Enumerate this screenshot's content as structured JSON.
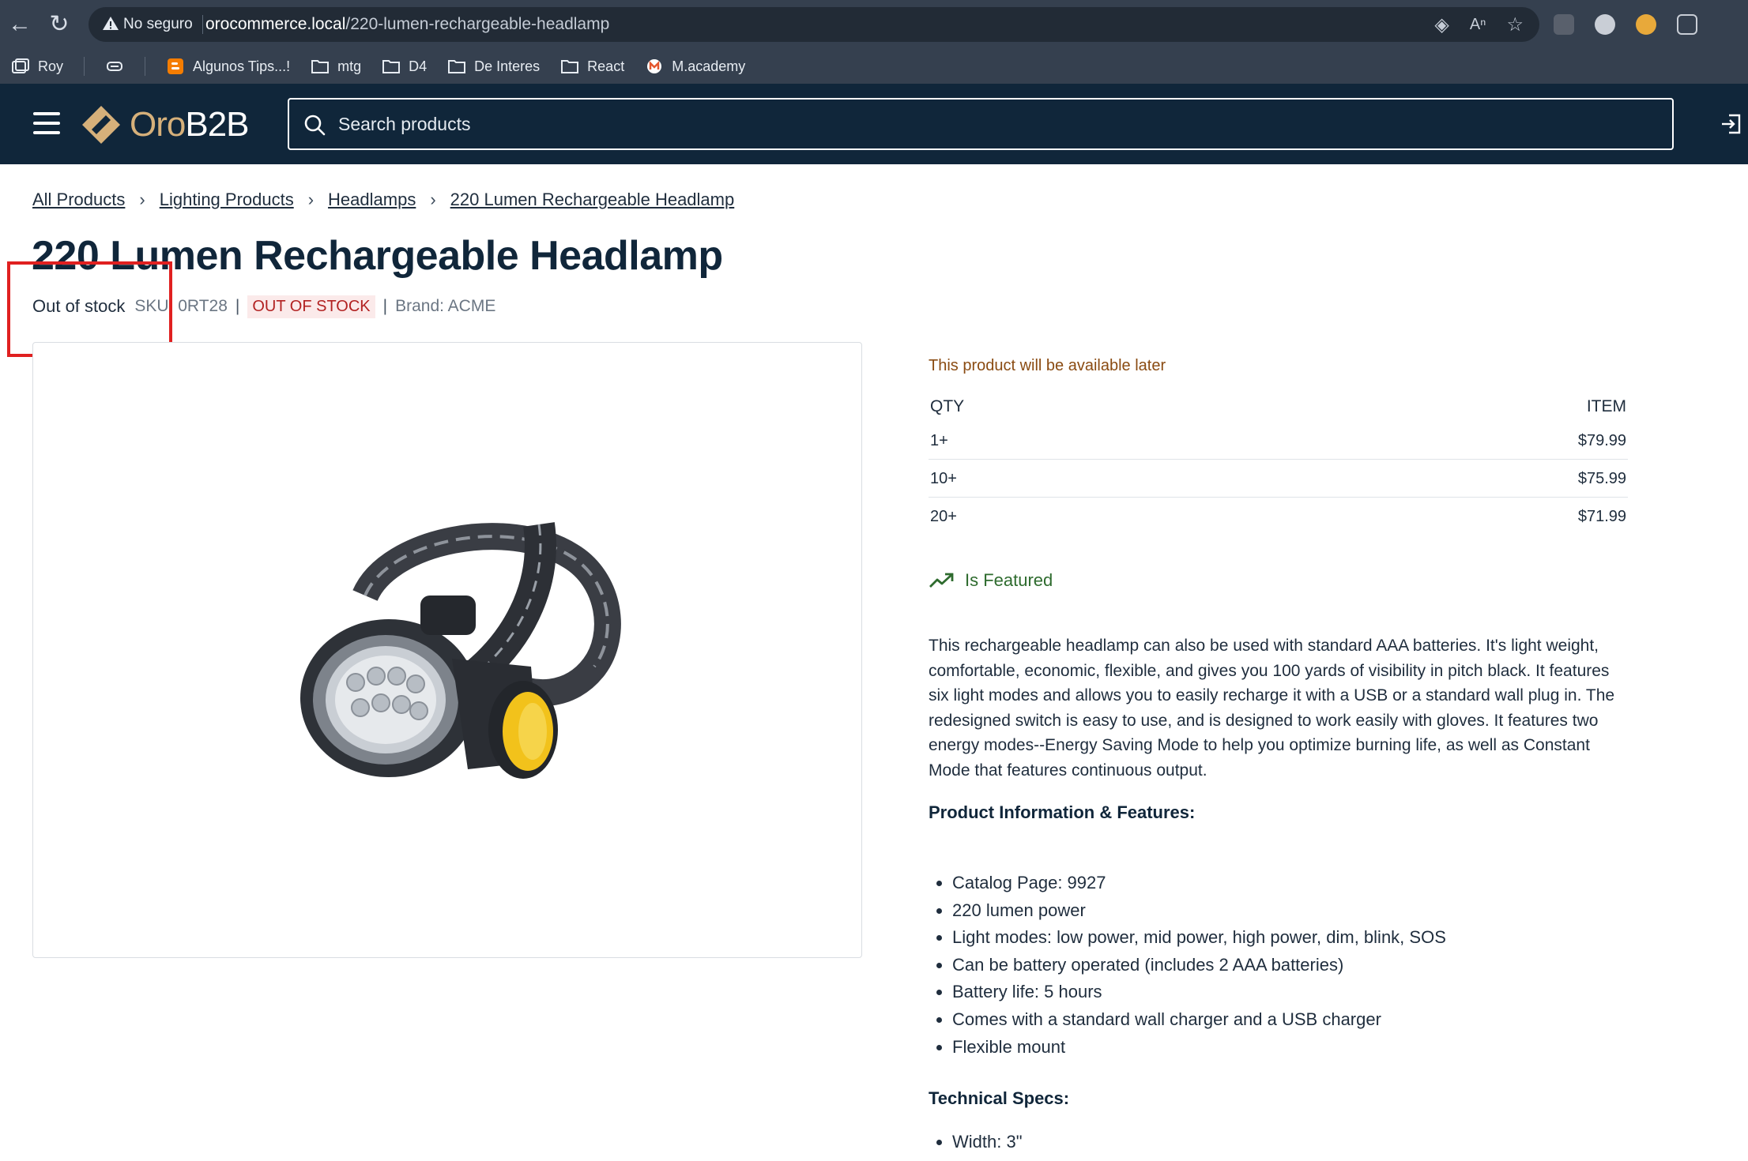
{
  "browser": {
    "security_label": "No seguro",
    "url_host": "orocommerce.local",
    "url_path": "/220-lumen-rechargeable-headlamp",
    "bookmarks": [
      {
        "label": "Roy"
      },
      {
        "label": "Algunos Tips...!"
      },
      {
        "label": "mtg"
      },
      {
        "label": "D4"
      },
      {
        "label": "De Interes"
      },
      {
        "label": "React"
      },
      {
        "label": "M.academy"
      }
    ]
  },
  "header": {
    "logo_prefix": "Oro",
    "logo_suffix": "B2B",
    "search_placeholder": "Search products"
  },
  "breadcrumb": [
    "All Products",
    "Lighting Products",
    "Headlamps",
    "220 Lumen Rechargeable Headlamp"
  ],
  "product": {
    "title": "220 Lumen Rechargeable Headlamp",
    "stock_text": "Out of stock",
    "sku": "SKU: 0RT28",
    "status_badge": "OUT OF STOCK",
    "brand": "Brand: ACME",
    "availability": "This product will be available later",
    "price_table": {
      "qty_header": "QTY",
      "item_header": "ITEM",
      "rows": [
        {
          "qty": "1+",
          "price": "$79.99"
        },
        {
          "qty": "10+",
          "price": "$75.99"
        },
        {
          "qty": "20+",
          "price": "$71.99"
        }
      ]
    },
    "featured_label": "Is Featured",
    "description": "This rechargeable headlamp can also be used with standard AAA batteries. It's light weight, comfortable, economic, flexible, and gives you 100 yards of visibility in pitch black. It features six light modes and allows you to easily recharge it with a USB or a standard wall plug in. The redesigned switch is easy to use, and is designed to work easily with gloves. It features two energy modes--Energy Saving Mode to help you optimize burning life, as well as Constant Mode that features continuous output.",
    "features_heading": "Product Information & Features:",
    "features": [
      "Catalog Page: 9927",
      "220 lumen power",
      "Light modes: low power, mid power, high power, dim, blink, SOS",
      "Can be battery operated (includes 2 AAA batteries)",
      "Battery life: 5 hours",
      "Comes with a standard wall charger and a USB charger",
      "Flexible mount"
    ],
    "specs_heading": "Technical Specs:",
    "specs": [
      "Width: 3\""
    ]
  },
  "colors": {
    "header_bg": "#10263a",
    "browser_bg": "#35404f",
    "accent_logo": "#d6b07a",
    "out_of_stock": "#b22222",
    "featured": "#2e6b2e",
    "highlight_box": "#e02020"
  }
}
